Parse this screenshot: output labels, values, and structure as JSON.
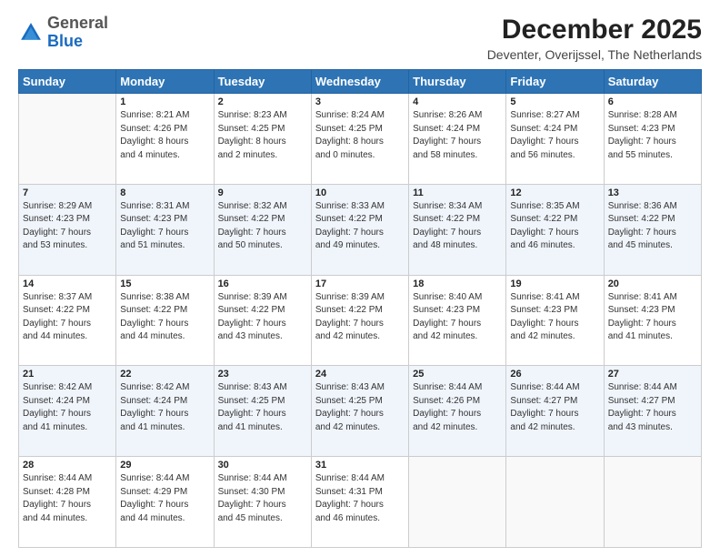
{
  "header": {
    "logo_general": "General",
    "logo_blue": "Blue",
    "month_title": "December 2025",
    "location": "Deventer, Overijssel, The Netherlands"
  },
  "weekdays": [
    "Sunday",
    "Monday",
    "Tuesday",
    "Wednesday",
    "Thursday",
    "Friday",
    "Saturday"
  ],
  "weeks": [
    [
      {
        "day": null,
        "data": null
      },
      {
        "day": "1",
        "data": "Sunrise: 8:21 AM\nSunset: 4:26 PM\nDaylight: 8 hours\nand 4 minutes."
      },
      {
        "day": "2",
        "data": "Sunrise: 8:23 AM\nSunset: 4:25 PM\nDaylight: 8 hours\nand 2 minutes."
      },
      {
        "day": "3",
        "data": "Sunrise: 8:24 AM\nSunset: 4:25 PM\nDaylight: 8 hours\nand 0 minutes."
      },
      {
        "day": "4",
        "data": "Sunrise: 8:26 AM\nSunset: 4:24 PM\nDaylight: 7 hours\nand 58 minutes."
      },
      {
        "day": "5",
        "data": "Sunrise: 8:27 AM\nSunset: 4:24 PM\nDaylight: 7 hours\nand 56 minutes."
      },
      {
        "day": "6",
        "data": "Sunrise: 8:28 AM\nSunset: 4:23 PM\nDaylight: 7 hours\nand 55 minutes."
      }
    ],
    [
      {
        "day": "7",
        "data": "Sunrise: 8:29 AM\nSunset: 4:23 PM\nDaylight: 7 hours\nand 53 minutes."
      },
      {
        "day": "8",
        "data": "Sunrise: 8:31 AM\nSunset: 4:23 PM\nDaylight: 7 hours\nand 51 minutes."
      },
      {
        "day": "9",
        "data": "Sunrise: 8:32 AM\nSunset: 4:22 PM\nDaylight: 7 hours\nand 50 minutes."
      },
      {
        "day": "10",
        "data": "Sunrise: 8:33 AM\nSunset: 4:22 PM\nDaylight: 7 hours\nand 49 minutes."
      },
      {
        "day": "11",
        "data": "Sunrise: 8:34 AM\nSunset: 4:22 PM\nDaylight: 7 hours\nand 48 minutes."
      },
      {
        "day": "12",
        "data": "Sunrise: 8:35 AM\nSunset: 4:22 PM\nDaylight: 7 hours\nand 46 minutes."
      },
      {
        "day": "13",
        "data": "Sunrise: 8:36 AM\nSunset: 4:22 PM\nDaylight: 7 hours\nand 45 minutes."
      }
    ],
    [
      {
        "day": "14",
        "data": "Sunrise: 8:37 AM\nSunset: 4:22 PM\nDaylight: 7 hours\nand 44 minutes."
      },
      {
        "day": "15",
        "data": "Sunrise: 8:38 AM\nSunset: 4:22 PM\nDaylight: 7 hours\nand 44 minutes."
      },
      {
        "day": "16",
        "data": "Sunrise: 8:39 AM\nSunset: 4:22 PM\nDaylight: 7 hours\nand 43 minutes."
      },
      {
        "day": "17",
        "data": "Sunrise: 8:39 AM\nSunset: 4:22 PM\nDaylight: 7 hours\nand 42 minutes."
      },
      {
        "day": "18",
        "data": "Sunrise: 8:40 AM\nSunset: 4:23 PM\nDaylight: 7 hours\nand 42 minutes."
      },
      {
        "day": "19",
        "data": "Sunrise: 8:41 AM\nSunset: 4:23 PM\nDaylight: 7 hours\nand 42 minutes."
      },
      {
        "day": "20",
        "data": "Sunrise: 8:41 AM\nSunset: 4:23 PM\nDaylight: 7 hours\nand 41 minutes."
      }
    ],
    [
      {
        "day": "21",
        "data": "Sunrise: 8:42 AM\nSunset: 4:24 PM\nDaylight: 7 hours\nand 41 minutes."
      },
      {
        "day": "22",
        "data": "Sunrise: 8:42 AM\nSunset: 4:24 PM\nDaylight: 7 hours\nand 41 minutes."
      },
      {
        "day": "23",
        "data": "Sunrise: 8:43 AM\nSunset: 4:25 PM\nDaylight: 7 hours\nand 41 minutes."
      },
      {
        "day": "24",
        "data": "Sunrise: 8:43 AM\nSunset: 4:25 PM\nDaylight: 7 hours\nand 42 minutes."
      },
      {
        "day": "25",
        "data": "Sunrise: 8:44 AM\nSunset: 4:26 PM\nDaylight: 7 hours\nand 42 minutes."
      },
      {
        "day": "26",
        "data": "Sunrise: 8:44 AM\nSunset: 4:27 PM\nDaylight: 7 hours\nand 42 minutes."
      },
      {
        "day": "27",
        "data": "Sunrise: 8:44 AM\nSunset: 4:27 PM\nDaylight: 7 hours\nand 43 minutes."
      }
    ],
    [
      {
        "day": "28",
        "data": "Sunrise: 8:44 AM\nSunset: 4:28 PM\nDaylight: 7 hours\nand 44 minutes."
      },
      {
        "day": "29",
        "data": "Sunrise: 8:44 AM\nSunset: 4:29 PM\nDaylight: 7 hours\nand 44 minutes."
      },
      {
        "day": "30",
        "data": "Sunrise: 8:44 AM\nSunset: 4:30 PM\nDaylight: 7 hours\nand 45 minutes."
      },
      {
        "day": "31",
        "data": "Sunrise: 8:44 AM\nSunset: 4:31 PM\nDaylight: 7 hours\nand 46 minutes."
      },
      {
        "day": null,
        "data": null
      },
      {
        "day": null,
        "data": null
      },
      {
        "day": null,
        "data": null
      }
    ]
  ]
}
